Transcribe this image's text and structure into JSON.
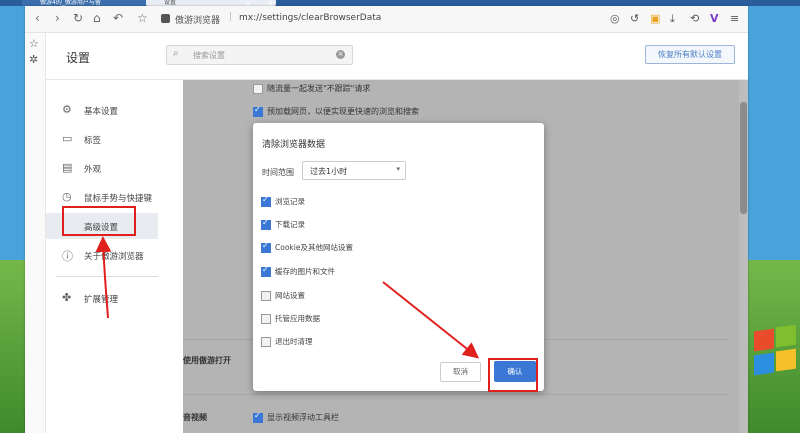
{
  "tabs": [
    {
      "label": "傲游4的_傲游用户与留"
    },
    {
      "label": "设置"
    }
  ],
  "toolbar": {
    "address_label": "傲游浏览器",
    "url": "mx://settings/clearBrowserData"
  },
  "header": {
    "title": "设置",
    "search_placeholder": "搜索设置",
    "restore_label": "恢复所有默认设置"
  },
  "sidebar": {
    "items": [
      {
        "label": "基本设置",
        "icon": "gear-icon"
      },
      {
        "label": "标签",
        "icon": "tab-icon"
      },
      {
        "label": "外观",
        "icon": "appearance-icon"
      },
      {
        "label": "鼠标手势与快捷键",
        "icon": "gesture-icon"
      },
      {
        "label": "高级设置",
        "icon": "sliders-icon"
      },
      {
        "label": "关于傲游浏览器",
        "icon": "info-icon"
      },
      {
        "label": "扩展管理",
        "icon": "puzzle-icon"
      }
    ],
    "active": "高级设置"
  },
  "content": {
    "row1": "随流量一起发送\"不跟踪\"请求",
    "row2": "预加载网页，以便实现更快速的浏览和搜索",
    "section_open": "使用傲游打开",
    "section_av": "音视频",
    "av_row": "显示视频浮动工具栏"
  },
  "dialog": {
    "title": "清除浏览器数据",
    "range_label": "时间范围",
    "range_value": "过去1小时",
    "options": [
      {
        "label": "浏览记录",
        "checked": true
      },
      {
        "label": "下载记录",
        "checked": true
      },
      {
        "label": "Cookie及其他网站设置",
        "checked": true
      },
      {
        "label": "缓存的图片和文件",
        "checked": true
      },
      {
        "label": "网站设置",
        "checked": false
      },
      {
        "label": "托管应用数据",
        "checked": false
      },
      {
        "label": "退出时清理",
        "checked": false
      }
    ],
    "cancel_label": "取消",
    "ok_label": "确认"
  },
  "colors": {
    "accent": "#3b78d6",
    "annotation": "#e0201c"
  }
}
